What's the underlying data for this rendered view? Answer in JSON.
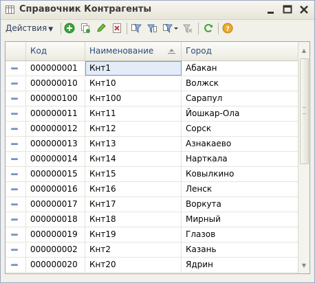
{
  "window": {
    "title": "Справочник Контрагенты"
  },
  "toolbar": {
    "actions_label": "Действия"
  },
  "grid": {
    "columns": [
      {
        "label": "Код"
      },
      {
        "label": "Наименование"
      },
      {
        "label": "Город"
      }
    ],
    "rows": [
      {
        "code": "000000001",
        "name": "Кнт1",
        "city": "Абакан"
      },
      {
        "code": "000000010",
        "name": "Кнт10",
        "city": "Волжск"
      },
      {
        "code": "000000100",
        "name": "Кнт100",
        "city": "Сарапул"
      },
      {
        "code": "000000011",
        "name": "Кнт11",
        "city": "Йошкар-Ола"
      },
      {
        "code": "000000012",
        "name": "Кнт12",
        "city": "Сорск"
      },
      {
        "code": "000000013",
        "name": "Кнт13",
        "city": "Азнакаево"
      },
      {
        "code": "000000014",
        "name": "Кнт14",
        "city": "Нарткала"
      },
      {
        "code": "000000015",
        "name": "Кнт15",
        "city": "Ковылкино"
      },
      {
        "code": "000000016",
        "name": "Кнт16",
        "city": "Ленск"
      },
      {
        "code": "000000017",
        "name": "Кнт17",
        "city": "Воркута"
      },
      {
        "code": "000000018",
        "name": "Кнт18",
        "city": "Мирный"
      },
      {
        "code": "000000019",
        "name": "Кнт19",
        "city": "Глазов"
      },
      {
        "code": "000000002",
        "name": "Кнт2",
        "city": "Казань"
      },
      {
        "code": "000000020",
        "name": "Кнт20",
        "city": "Ядрин"
      }
    ],
    "sorted_column": "Наименование",
    "selected_row": 0
  },
  "icons": {
    "title": "table-icon",
    "minimize": "minimize-icon",
    "maximize": "maximize-icon",
    "close": "close-icon",
    "add": "add-icon",
    "copy": "copy-icon",
    "edit": "edit-icon",
    "delete": "delete-icon",
    "filter_set": "filter-set-icon",
    "filter_column": "filter-column-icon",
    "filter_dropdown": "filter-dropdown-icon",
    "filter_off": "filter-off-icon",
    "refresh": "refresh-icon",
    "help": "help-icon"
  },
  "colors": {
    "accent": "#2d4978",
    "selection": "#e3ecf8",
    "add_green": "#3aa43a",
    "delete_red": "#d23b3b"
  }
}
